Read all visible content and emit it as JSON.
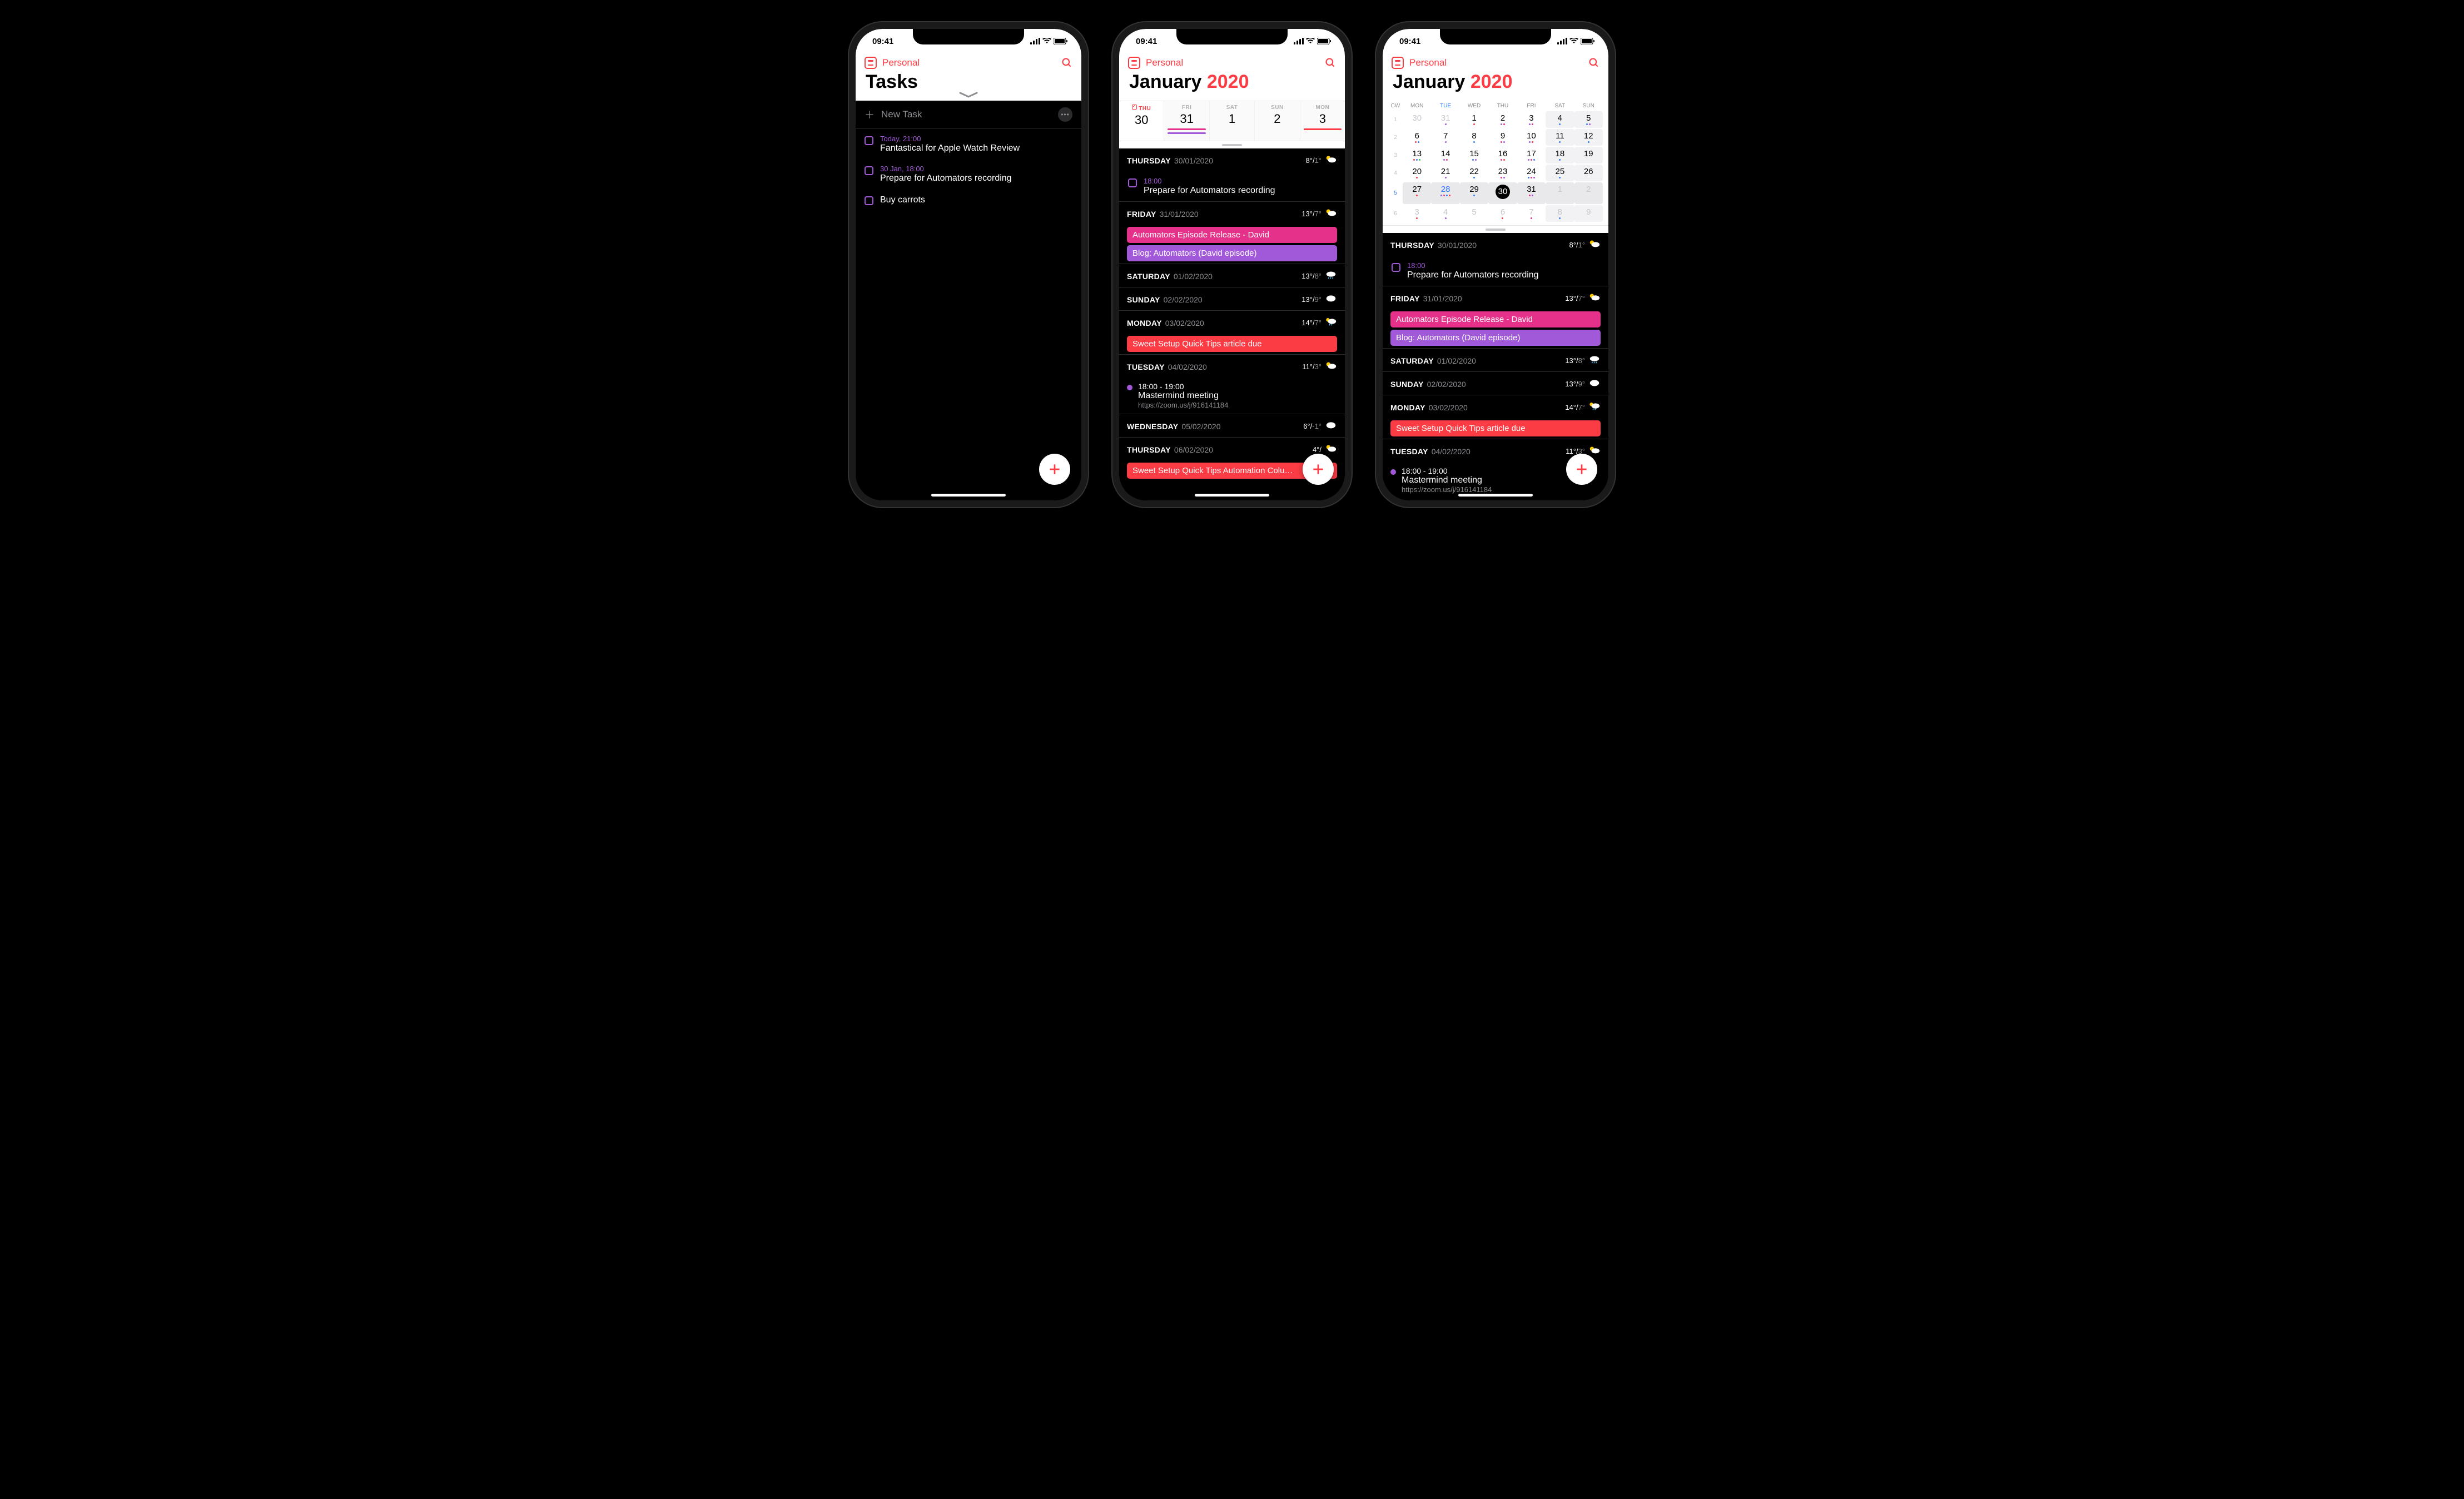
{
  "status": {
    "time": "09:41"
  },
  "nav": {
    "calendarSet": "Personal"
  },
  "tasks": {
    "title": "Tasks",
    "newTask": "New Task",
    "items": [
      {
        "time": "Today, 21:00",
        "title": "Fantastical for Apple Watch Review"
      },
      {
        "time": "30 Jan, 18:00",
        "title": "Prepare for Automators recording"
      },
      {
        "time": "",
        "title": "Buy carrots"
      }
    ]
  },
  "monthTitle": {
    "month": "January",
    "year": "2020"
  },
  "weekCols": [
    {
      "name": "THU",
      "num": "30",
      "sel": true,
      "check": true,
      "barColor": ""
    },
    {
      "name": "FRI",
      "num": "31",
      "barColor": "#e6318a,#a259d9"
    },
    {
      "name": "SAT",
      "num": "1",
      "barColor": ""
    },
    {
      "name": "SUN",
      "num": "2",
      "barColor": ""
    },
    {
      "name": "MON",
      "num": "3",
      "barColor": "#fc3c44"
    }
  ],
  "monthGrid": {
    "headers": [
      "CW",
      "MON",
      "TUE",
      "WED",
      "THU",
      "FRI",
      "SAT",
      "SUN"
    ],
    "rows": [
      {
        "cw": "1",
        "days": [
          {
            "n": "30",
            "dim": true,
            "d": []
          },
          {
            "n": "31",
            "dim": true,
            "d": [
              "#a259d9"
            ]
          },
          {
            "n": "1",
            "d": [
              "#fc3c44"
            ]
          },
          {
            "n": "2",
            "d": [
              "#a259d9",
              "#e6318a"
            ]
          },
          {
            "n": "3",
            "d": [
              "#a259d9",
              "#e6318a"
            ]
          },
          {
            "n": "4",
            "wknd": true,
            "d": [
              "#3478f6"
            ]
          },
          {
            "n": "5",
            "wknd": true,
            "d": [
              "#3478f6",
              "#a259d9"
            ]
          }
        ]
      },
      {
        "cw": "2",
        "days": [
          {
            "n": "6",
            "d": [
              "#fc3c44",
              "#3478f6"
            ]
          },
          {
            "n": "7",
            "d": [
              "#a259d9"
            ]
          },
          {
            "n": "8",
            "d": [
              "#3478f6"
            ]
          },
          {
            "n": "9",
            "d": [
              "#e6318a",
              "#a259d9"
            ]
          },
          {
            "n": "10",
            "d": [
              "#a259d9",
              "#fc3c44"
            ]
          },
          {
            "n": "11",
            "wknd": true,
            "d": [
              "#3478f6"
            ]
          },
          {
            "n": "12",
            "wknd": true,
            "d": [
              "#3478f6"
            ]
          }
        ]
      },
      {
        "cw": "3",
        "days": [
          {
            "n": "13",
            "d": [
              "#fc3c44",
              "#3478f6",
              "#34c759"
            ]
          },
          {
            "n": "14",
            "d": [
              "#a259d9",
              "#e6318a"
            ]
          },
          {
            "n": "15",
            "d": [
              "#3478f6",
              "#a259d9"
            ]
          },
          {
            "n": "16",
            "d": [
              "#e6318a",
              "#fc3c44"
            ]
          },
          {
            "n": "17",
            "d": [
              "#a259d9",
              "#e6318a",
              "#3478f6"
            ]
          },
          {
            "n": "18",
            "wknd": true,
            "d": [
              "#3478f6"
            ]
          },
          {
            "n": "19",
            "wknd": true,
            "d": []
          }
        ]
      },
      {
        "cw": "4",
        "days": [
          {
            "n": "20",
            "d": [
              "#fc3c44"
            ]
          },
          {
            "n": "21",
            "d": [
              "#a259d9"
            ]
          },
          {
            "n": "22",
            "d": [
              "#3478f6"
            ]
          },
          {
            "n": "23",
            "d": [
              "#e6318a",
              "#a259d9"
            ]
          },
          {
            "n": "24",
            "d": [
              "#3478f6",
              "#e6318a",
              "#a259d9"
            ]
          },
          {
            "n": "25",
            "wknd": true,
            "d": [
              "#3478f6"
            ]
          },
          {
            "n": "26",
            "wknd": true,
            "d": []
          }
        ]
      },
      {
        "cw": "5",
        "sel": true,
        "days": [
          {
            "n": "27",
            "d": [
              "#fc3c44"
            ]
          },
          {
            "n": "28",
            "blue": true,
            "d": [
              "#a259d9",
              "#e6318a",
              "#3478f6",
              "#fc3c44"
            ]
          },
          {
            "n": "29",
            "d": [
              "#3478f6"
            ]
          },
          {
            "n": "30",
            "today": true,
            "d": []
          },
          {
            "n": "31",
            "d": [
              "#e6318a",
              "#a259d9"
            ]
          },
          {
            "n": "1",
            "dim": true,
            "wknd": true,
            "d": []
          },
          {
            "n": "2",
            "dim": true,
            "wknd": true,
            "d": []
          }
        ]
      },
      {
        "cw": "6",
        "days": [
          {
            "n": "3",
            "dim": true,
            "d": [
              "#fc3c44"
            ]
          },
          {
            "n": "4",
            "dim": true,
            "d": [
              "#a259d9"
            ]
          },
          {
            "n": "5",
            "dim": true,
            "d": []
          },
          {
            "n": "6",
            "dim": true,
            "d": [
              "#fc3c44"
            ]
          },
          {
            "n": "7",
            "dim": true,
            "d": [
              "#e6318a"
            ]
          },
          {
            "n": "8",
            "dim": true,
            "wknd": true,
            "d": [
              "#3478f6"
            ]
          },
          {
            "n": "9",
            "dim": true,
            "wknd": true,
            "d": []
          }
        ]
      }
    ]
  },
  "agenda": [
    {
      "type": "header",
      "name": "THURSDAY",
      "date": "30/01/2020",
      "hi": "8°",
      "lo": "1°",
      "wx": "partly"
    },
    {
      "type": "task",
      "time": "18:00",
      "title": "Prepare for Automators recording"
    },
    {
      "type": "header",
      "name": "FRIDAY",
      "date": "31/01/2020",
      "hi": "13°",
      "lo": "7°",
      "wx": "partly"
    },
    {
      "type": "chip",
      "color": "#e6318a",
      "title": "Automators Episode Release - David"
    },
    {
      "type": "chip",
      "color": "#a259d9",
      "title": "Blog: Automators (David episode)"
    },
    {
      "type": "header",
      "name": "SATURDAY",
      "date": "01/02/2020",
      "hi": "13°",
      "lo": "8°",
      "wx": "rain"
    },
    {
      "type": "header",
      "name": "SUNDAY",
      "date": "02/02/2020",
      "hi": "13°",
      "lo": "9°",
      "wx": "cloudy"
    },
    {
      "type": "header",
      "name": "MONDAY",
      "date": "03/02/2020",
      "hi": "14°",
      "lo": "7°",
      "wx": "partly-rain"
    },
    {
      "type": "chip",
      "color": "#fc3c44",
      "title": "Sweet Setup Quick Tips article due"
    },
    {
      "type": "header",
      "name": "TUESDAY",
      "date": "04/02/2020",
      "hi": "11°",
      "lo": "3°",
      "wx": "partly"
    },
    {
      "type": "event",
      "dot": "#a259d9",
      "time": "18:00 - 19:00",
      "title": "Mastermind meeting",
      "sub": "https://zoom.us/j/916141184"
    },
    {
      "type": "header",
      "name": "WEDNESDAY",
      "date": "05/02/2020",
      "hi": "6°",
      "lo": "-1°",
      "wx": "cloudy"
    },
    {
      "type": "header",
      "name": "THURSDAY",
      "date": "06/02/2020",
      "hi": "4°",
      "lo": "",
      "wx": "partly"
    },
    {
      "type": "chip",
      "color": "#fc3c44",
      "title": "Sweet Setup Quick Tips Automation Colu…"
    }
  ],
  "agenda3": [
    {
      "type": "header",
      "name": "THURSDAY",
      "date": "30/01/2020",
      "hi": "8°",
      "lo": "1°",
      "wx": "partly"
    },
    {
      "type": "task",
      "time": "18:00",
      "title": "Prepare for Automators recording"
    },
    {
      "type": "header",
      "name": "FRIDAY",
      "date": "31/01/2020",
      "hi": "13°",
      "lo": "7°",
      "wx": "partly"
    },
    {
      "type": "chip",
      "color": "#e6318a",
      "title": "Automators Episode Release - David"
    },
    {
      "type": "chip",
      "color": "#a259d9",
      "title": "Blog: Automators (David episode)"
    },
    {
      "type": "header",
      "name": "SATURDAY",
      "date": "01/02/2020",
      "hi": "13°",
      "lo": "8°",
      "wx": "rain"
    },
    {
      "type": "header",
      "name": "SUNDAY",
      "date": "02/02/2020",
      "hi": "13°",
      "lo": "9°",
      "wx": "cloudy"
    },
    {
      "type": "header",
      "name": "MONDAY",
      "date": "03/02/2020",
      "hi": "14°",
      "lo": "7°",
      "wx": "partly-rain"
    },
    {
      "type": "chip",
      "color": "#fc3c44",
      "title": "Sweet Setup Quick Tips article due"
    },
    {
      "type": "header",
      "name": "TUESDAY",
      "date": "04/02/2020",
      "hi": "11°",
      "lo": "3°",
      "wx": "partly"
    },
    {
      "type": "event",
      "dot": "#a259d9",
      "time": "18:00 - 19:00",
      "title": "Mastermind meeting",
      "sub": "https://zoom.us/j/916141184"
    }
  ]
}
